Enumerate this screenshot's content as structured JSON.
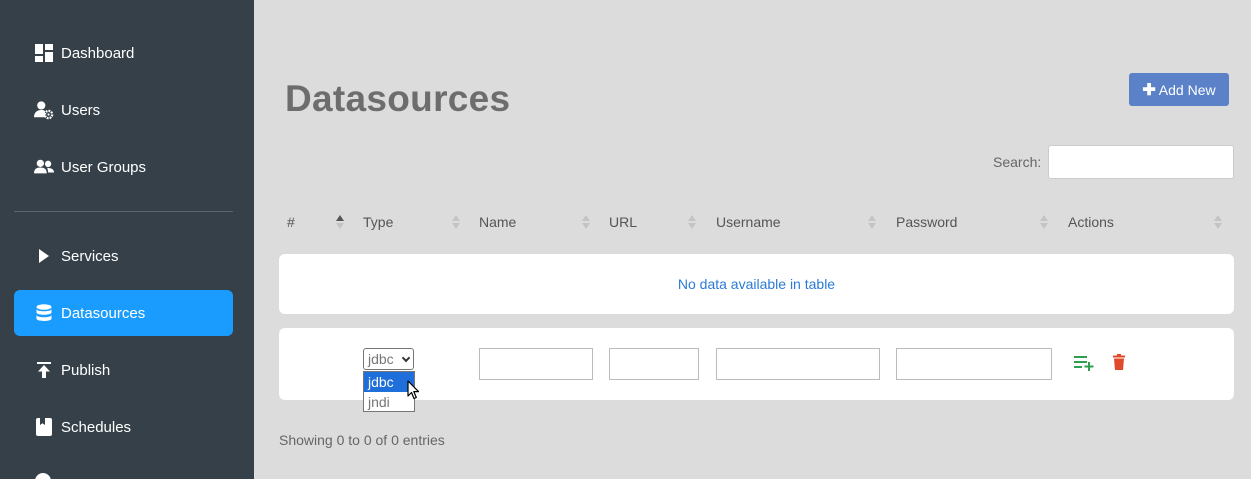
{
  "sidebar": {
    "items": [
      {
        "label": "Dashboard",
        "icon": "dashboard-icon"
      },
      {
        "label": "Users",
        "icon": "user-gear-icon"
      },
      {
        "label": "User Groups",
        "icon": "user-group-icon"
      },
      {
        "label": "Services",
        "icon": "play-icon"
      },
      {
        "label": "Datasources",
        "icon": "database-icon",
        "active": true
      },
      {
        "label": "Publish",
        "icon": "upload-icon"
      },
      {
        "label": "Schedules",
        "icon": "bookmark-icon"
      }
    ]
  },
  "page": {
    "title": "Datasources",
    "add_button": "Add New",
    "search_label": "Search:",
    "search_value": ""
  },
  "table": {
    "columns": [
      "#",
      "Type",
      "Name",
      "URL",
      "Username",
      "Password",
      "Actions"
    ],
    "sorted_column": "#",
    "empty_message": "No data available in table",
    "edit_row": {
      "type_selected": "jdbc",
      "type_options": [
        "jdbc",
        "jndi"
      ],
      "highlighted_option": "jdbc",
      "name": "",
      "url": "",
      "username": "",
      "password": ""
    },
    "info": "Showing 0 to 0 of 0 entries"
  },
  "colors": {
    "sidebar_bg": "#354048",
    "active_item": "#1a9cff",
    "add_button": "#5b82c9",
    "add_icon": "#2e9e4f",
    "delete_icon": "#e04a2a"
  }
}
